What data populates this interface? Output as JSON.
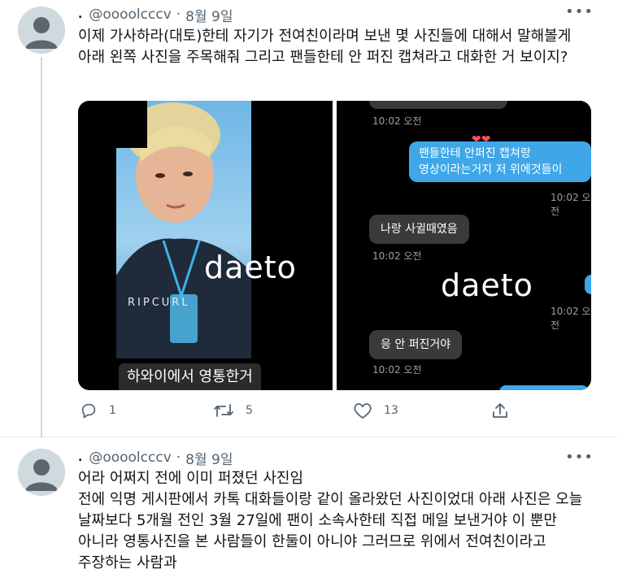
{
  "tweets": [
    {
      "handle": "@oooolcccv",
      "date": "8월 9일",
      "more": "•••",
      "text": "이제 가사하라(대토)한테 자기가 전여친이라며 보낸 몇 사진들에 대해서 말해볼게 아래 왼쪽 사진을 주목해줘 그리고 팬들한테 안 퍼진 캡쳐라고 대화한 거 보이지?",
      "media": {
        "left": {
          "watermark": "daeto",
          "caption": "하와이에서 영통한거"
        },
        "right": {
          "watermark": "daeto",
          "messages": [
            {
              "type": "time",
              "text": "10:02 오전"
            },
            {
              "type": "out",
              "text": "팬들한테 안퍼진 캡쳐랑\n영상이라는거지 저 위에것들이"
            },
            {
              "type": "time",
              "text": "10:02 오전"
            },
            {
              "type": "in",
              "text": "나랑 사귈때였음"
            },
            {
              "type": "time",
              "text": "10:02 오전"
            },
            {
              "type": "time",
              "text": "10:02 오전"
            },
            {
              "type": "in",
              "text": "응 안 퍼진거야"
            },
            {
              "type": "time",
              "text": "10:02 오전"
            }
          ],
          "heart": "❤❤"
        }
      },
      "actions": {
        "reply": "1",
        "retweet": "5",
        "like": "13"
      }
    },
    {
      "handle": "@oooolcccv",
      "date": "8월 9일",
      "more": "•••",
      "text": "어라 어쩌지 전에 이미 퍼졌던 사진임\n전에 익명 게시판에서 카톡 대화들이랑 같이 올라왔던 사진이었대 아래 사진은 오늘 날짜보다 5개월 전인 3월 27일에 팬이 소속사한테 직접 메일 보낸거야 이 뿐만 아니라 영통사진을 본 사람들이 한둘이 아니야 그러므로 위에서 전여친이라고 주장하는 사람과"
    }
  ],
  "colors": {
    "accent": "#1d9bf0",
    "bubble_out": "#3fa7e8",
    "bubble_in": "#3a3a3c",
    "muted": "#536471"
  }
}
